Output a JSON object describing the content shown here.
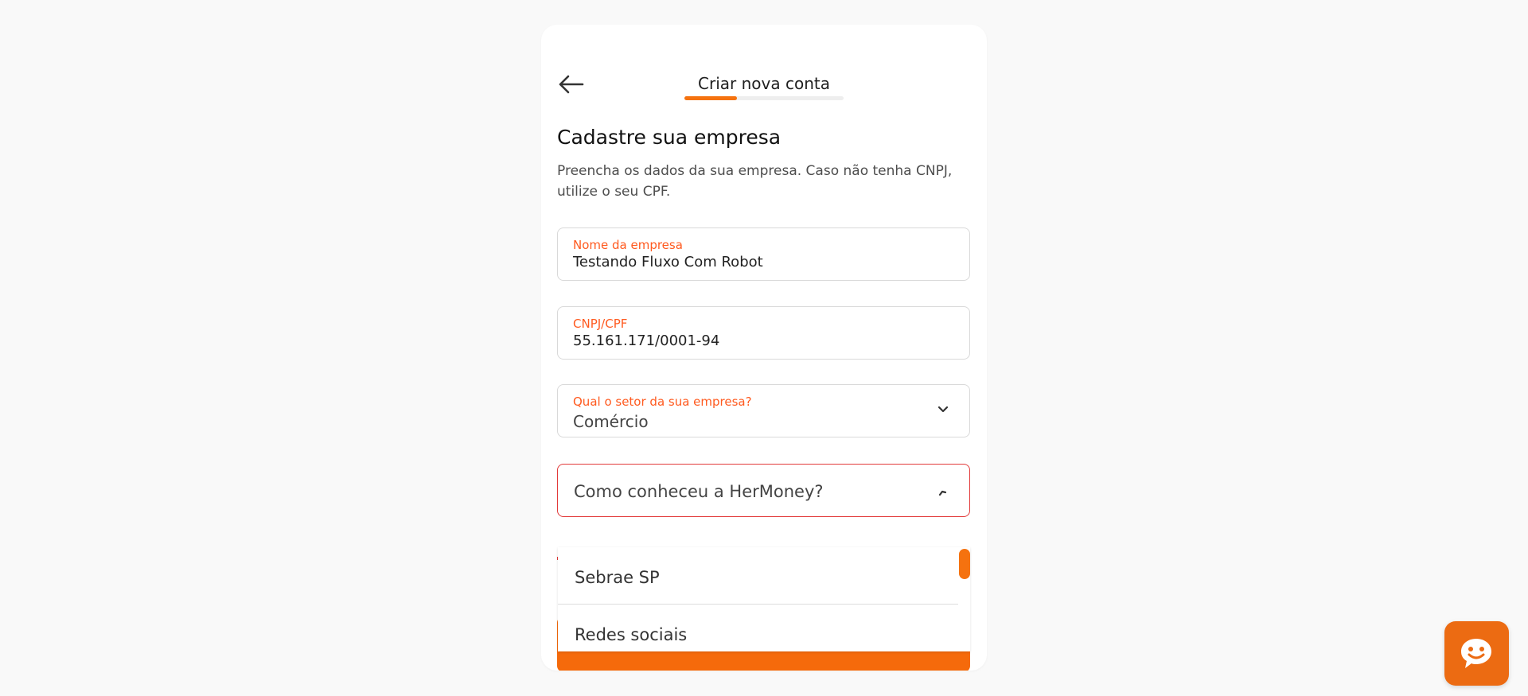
{
  "header": {
    "title": "Criar nova conta",
    "progress": 0.33
  },
  "form": {
    "title": "Cadastre sua empresa",
    "description": "Preencha os dados da sua empresa. Caso não tenha CNPJ, utilize o seu CPF.",
    "company_name": {
      "label": "Nome da empresa",
      "value": "Testando Fluxo Com Robot"
    },
    "document": {
      "label": "CNPJ/CPF",
      "value": "55.161.171/0001-94"
    },
    "sector": {
      "label": "Qual o setor da sua empresa?",
      "value": "Comércio"
    },
    "referral": {
      "placeholder": "Como conheceu a HerMoney?",
      "options": [
        "Sebrae SP",
        "Redes sociais"
      ]
    }
  },
  "colors": {
    "accent": "#f5720f",
    "label": "#ff5a1f",
    "error_border": "#e23a3a",
    "chat_button": "#ec6b12"
  },
  "icons": {
    "back": "arrow-left-icon",
    "chevron_down": "chevron-down-icon",
    "chevron_up": "chevron-up-icon",
    "chat": "chat-bubble-icon"
  }
}
